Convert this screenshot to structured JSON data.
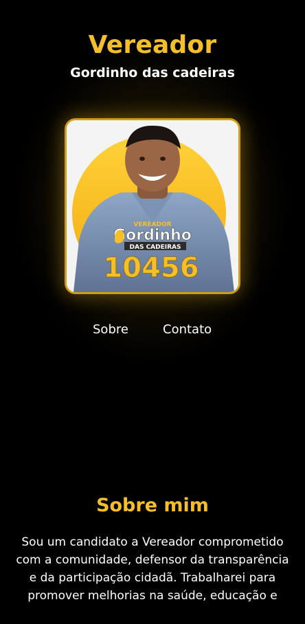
{
  "header": {
    "title": "Vereador",
    "subtitle": "Gordinho das cadeiras"
  },
  "photo": {
    "badge_small": "VEREADOR",
    "badge_name": "Gordinho",
    "badge_sub": "DAS CADEIRAS",
    "number": "10456"
  },
  "nav": {
    "items": [
      {
        "label": "Sobre"
      },
      {
        "label": "Contato"
      }
    ]
  },
  "about": {
    "title": "Sobre mim",
    "text": "Sou um candidato a Vereador comprometido com a comunidade, defensor da transparência e da participação cidadã. Trabalharei para promover melhorias na saúde, educação e"
  },
  "colors": {
    "accent": "#f6bf2a",
    "background": "#000000",
    "text": "#ffffff",
    "frame": "#d19d16"
  }
}
